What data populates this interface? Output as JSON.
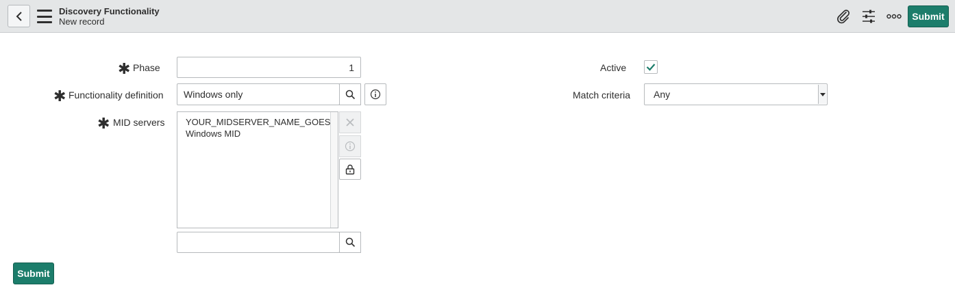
{
  "header": {
    "title": "Discovery Functionality",
    "subtitle": "New record",
    "submit_label": "Submit",
    "icons": [
      "chevron-left-icon",
      "menu-icon",
      "paperclip-icon",
      "sliders-icon",
      "more-icon"
    ]
  },
  "form": {
    "phase": {
      "label": "Phase",
      "required": true,
      "value": "1"
    },
    "functionality_definition": {
      "label": "Functionality definition",
      "required": true,
      "value": "Windows only"
    },
    "mid_servers": {
      "label": "MID servers",
      "required": true,
      "items": [
        "YOUR_MIDSERVER_NAME_GOES_HERE",
        "Windows MID"
      ],
      "search_value": ""
    },
    "active": {
      "label": "Active",
      "checked": true
    },
    "match_criteria": {
      "label": "Match criteria",
      "value": "Any"
    },
    "required_marker": "✱"
  },
  "footer": {
    "submit_label": "Submit"
  },
  "colors": {
    "accent": "#1c7d6b",
    "header_bg": "#e4e6e7"
  }
}
